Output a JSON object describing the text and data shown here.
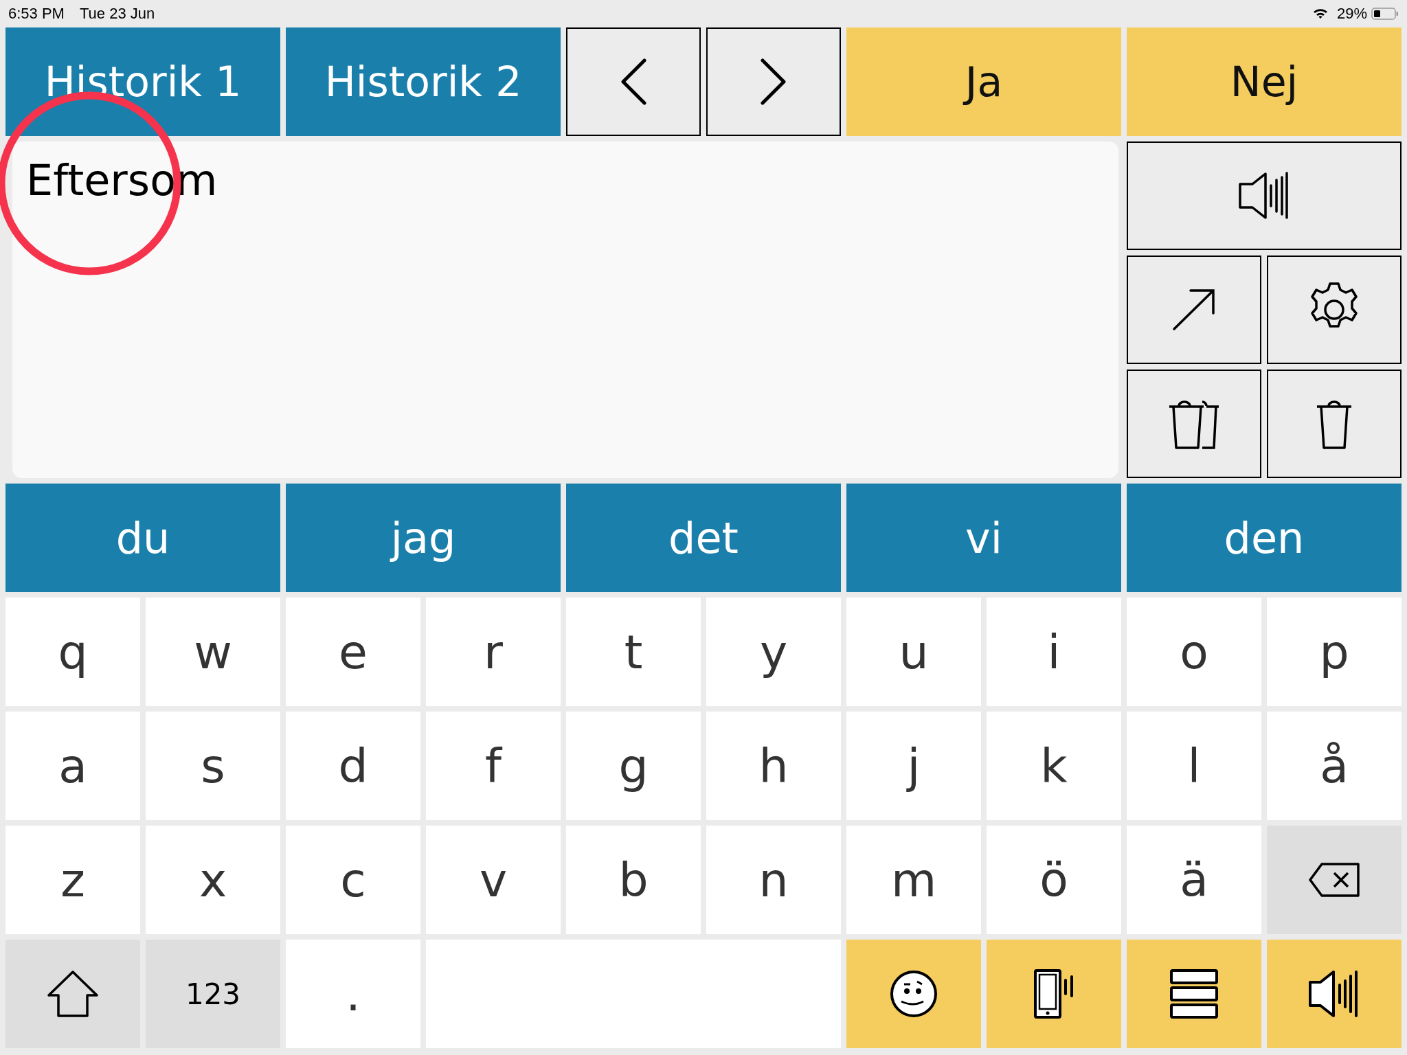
{
  "status_bar": {
    "time": "6:53 PM",
    "date": "Tue 23 Jun",
    "battery": "29%"
  },
  "top_bar": [
    {
      "kind": "history",
      "label": "Historik 1"
    },
    {
      "kind": "history",
      "label": "Historik 2"
    },
    {
      "kind": "back"
    },
    {
      "kind": "forward"
    },
    {
      "kind": "answer",
      "label": "Ja"
    },
    {
      "kind": "answer",
      "label": "Nej"
    }
  ],
  "message": {
    "value": "Eftersom"
  },
  "side_tools": [
    {
      "kind": "speak"
    },
    {
      "kind": "expand"
    },
    {
      "kind": "settings"
    },
    {
      "kind": "clear-all"
    },
    {
      "kind": "clear"
    }
  ],
  "suggestions": [
    "du",
    "jag",
    "det",
    "vi",
    "den"
  ],
  "keyboard": [
    [
      {
        "kind": "letter",
        "label": "q"
      },
      {
        "kind": "letter",
        "label": "w"
      },
      {
        "kind": "letter",
        "label": "e"
      },
      {
        "kind": "letter",
        "label": "r"
      },
      {
        "kind": "letter",
        "label": "t"
      },
      {
        "kind": "letter",
        "label": "y"
      },
      {
        "kind": "letter",
        "label": "u"
      },
      {
        "kind": "letter",
        "label": "i"
      },
      {
        "kind": "letter",
        "label": "o"
      },
      {
        "kind": "letter",
        "label": "p"
      }
    ],
    [
      {
        "kind": "letter",
        "label": "a"
      },
      {
        "kind": "letter",
        "label": "s"
      },
      {
        "kind": "letter",
        "label": "d"
      },
      {
        "kind": "letter",
        "label": "f"
      },
      {
        "kind": "letter",
        "label": "g"
      },
      {
        "kind": "letter",
        "label": "h"
      },
      {
        "kind": "letter",
        "label": "j"
      },
      {
        "kind": "letter",
        "label": "k"
      },
      {
        "kind": "letter",
        "label": "l"
      },
      {
        "kind": "letter",
        "label": "å"
      }
    ],
    [
      {
        "kind": "letter",
        "label": "z"
      },
      {
        "kind": "letter",
        "label": "x"
      },
      {
        "kind": "letter",
        "label": "c"
      },
      {
        "kind": "letter",
        "label": "v"
      },
      {
        "kind": "letter",
        "label": "b"
      },
      {
        "kind": "letter",
        "label": "n"
      },
      {
        "kind": "letter",
        "label": "m"
      },
      {
        "kind": "letter",
        "label": "ö"
      },
      {
        "kind": "letter",
        "label": "ä"
      },
      {
        "kind": "backspace"
      }
    ],
    [
      {
        "kind": "shift"
      },
      {
        "kind": "mode",
        "label": "123"
      },
      {
        "kind": "letter",
        "label": "."
      },
      {
        "kind": "space"
      },
      {
        "kind": "emoji"
      },
      {
        "kind": "phone"
      },
      {
        "kind": "list"
      },
      {
        "kind": "speak"
      }
    ]
  ],
  "annotations": [
    {
      "kind": "circle"
    }
  ]
}
